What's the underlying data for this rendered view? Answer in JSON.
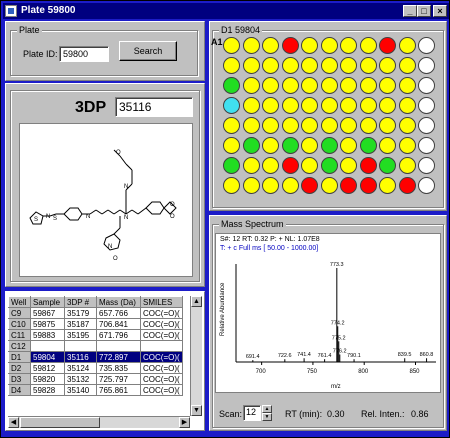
{
  "window": {
    "title": "Plate 59800",
    "min": "_",
    "max": "□",
    "close": "×"
  },
  "plate_group": {
    "label": "Plate",
    "id_label": "Plate ID:",
    "id_value": "59800",
    "search": "Search"
  },
  "compound": {
    "label": "3DP",
    "value": "35116"
  },
  "plate_view": {
    "title": "D1 59804",
    "row_label": "A1",
    "colors": {
      "yellow": "#ffff00",
      "red": "#ff0000",
      "green": "#22dd22",
      "white": "#ffffff",
      "cyan": "#40e0f0"
    },
    "rows": [
      [
        "yellow",
        "yellow",
        "yellow",
        "red",
        "yellow",
        "yellow",
        "yellow",
        "yellow",
        "red",
        "yellow",
        "white"
      ],
      [
        "yellow",
        "yellow",
        "yellow",
        "yellow",
        "yellow",
        "yellow",
        "yellow",
        "yellow",
        "yellow",
        "yellow",
        "white"
      ],
      [
        "green",
        "yellow",
        "yellow",
        "yellow",
        "yellow",
        "yellow",
        "yellow",
        "yellow",
        "yellow",
        "yellow",
        "white"
      ],
      [
        "cyan",
        "yellow",
        "yellow",
        "yellow",
        "yellow",
        "yellow",
        "yellow",
        "yellow",
        "yellow",
        "yellow",
        "white"
      ],
      [
        "yellow",
        "yellow",
        "yellow",
        "yellow",
        "yellow",
        "yellow",
        "yellow",
        "yellow",
        "yellow",
        "yellow",
        "white"
      ],
      [
        "yellow",
        "green",
        "yellow",
        "green",
        "yellow",
        "green",
        "yellow",
        "green",
        "yellow",
        "yellow",
        "white"
      ],
      [
        "green",
        "yellow",
        "yellow",
        "red",
        "yellow",
        "green",
        "yellow",
        "red",
        "green",
        "yellow",
        "white"
      ],
      [
        "yellow",
        "yellow",
        "yellow",
        "yellow",
        "red",
        "yellow",
        "red",
        "red",
        "yellow",
        "red",
        "white"
      ]
    ]
  },
  "table": {
    "headers": [
      "Well",
      "Sample",
      "3DP #",
      "Mass (Da)",
      "SMILES"
    ],
    "rows": [
      [
        "C9",
        "59867",
        "35179",
        "657.766",
        "COC(=O)("
      ],
      [
        "C10",
        "59875",
        "35187",
        "706.841",
        "COC(=O)("
      ],
      [
        "C11",
        "59883",
        "35195",
        "671.796",
        "COC(=O)("
      ],
      [
        "C12",
        "",
        "",
        "",
        ""
      ],
      [
        "D1",
        "59804",
        "35116",
        "772.897",
        "COC(=O)("
      ],
      [
        "D2",
        "59812",
        "35124",
        "735.835",
        "COC(=O)("
      ],
      [
        "D3",
        "59820",
        "35132",
        "725.797",
        "COC(=O)("
      ],
      [
        "D4",
        "59828",
        "35140",
        "765.861",
        "COC(=O)("
      ]
    ],
    "selected_row": 4
  },
  "mass_spectrum": {
    "title": "Mass Spectrum",
    "header_line1": "S#: 12  RT: 0.32  P: +  NL: 1.07E8",
    "header_line2": "T: + c Full ms [ 50.00 - 1000.00]",
    "ylabel": "Relative Abundance",
    "xlabel": "m/z",
    "xticks": [
      "700",
      "750",
      "800",
      "850"
    ],
    "chart_data": {
      "type": "bar",
      "xlabel": "m/z",
      "ylabel": "Relative Abundance",
      "xlim": [
        675,
        870
      ],
      "ylim": [
        0,
        100
      ],
      "x": [
        691.4,
        722.6,
        741.4,
        761.4,
        773.3,
        774.2,
        775.2,
        776.2,
        790.1,
        839.5,
        860.8
      ],
      "values": [
        2,
        3,
        4,
        3,
        100,
        38,
        22,
        8,
        3,
        4,
        4
      ]
    },
    "peak_labels": [
      "691.4",
      "722.6",
      "741.4",
      "761.4",
      "773.3",
      "774.2",
      "775.2",
      "776.2",
      "790.1",
      "839.5",
      "860.8"
    ]
  },
  "footer": {
    "scan_label": "Scan:",
    "scan_value": "12",
    "rt_label": "RT (min):",
    "rt_value": "0.30",
    "rel_label": "Rel. Inten.:",
    "rel_value": "0.86"
  }
}
